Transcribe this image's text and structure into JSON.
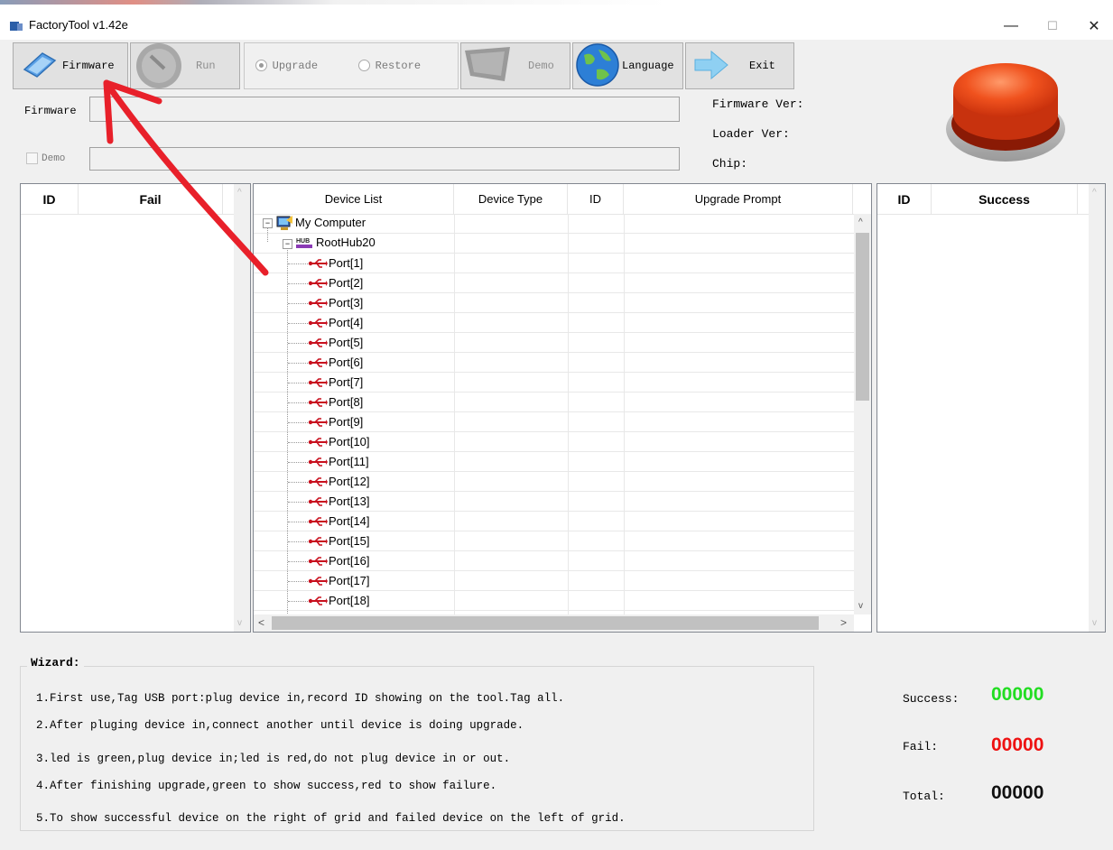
{
  "window": {
    "title": "FactoryTool v1.42e",
    "controls": {
      "minimize": "—",
      "maximize": "☐",
      "close": "✕"
    }
  },
  "toolbar": {
    "firmware_label": "Firmware",
    "run_label": "Run",
    "upgrade_label": "Upgrade",
    "restore_label": "Restore",
    "demo_label": "Demo",
    "language_label": "Language",
    "exit_label": "Exit",
    "selected_mode": "Upgrade"
  },
  "form": {
    "firmware_label": "Firmware",
    "firmware_value": "",
    "demo_checkbox_label": "Demo",
    "demo_checked": false,
    "demo_value": ""
  },
  "info": {
    "firmware_ver_label": "Firmware Ver:",
    "loader_ver_label": "Loader Ver:",
    "chip_label": "Chip:"
  },
  "fail_grid": {
    "headers": [
      "ID",
      "Fail"
    ],
    "rows": []
  },
  "success_grid": {
    "headers": [
      "ID",
      "Success"
    ],
    "rows": []
  },
  "device_grid": {
    "headers": [
      "Device List",
      "Device Type",
      "ID",
      "Upgrade Prompt"
    ],
    "root": "My Computer",
    "hub": "RootHub20",
    "ports": [
      "Port[1]",
      "Port[2]",
      "Port[3]",
      "Port[4]",
      "Port[5]",
      "Port[6]",
      "Port[7]",
      "Port[8]",
      "Port[9]",
      "Port[10]",
      "Port[11]",
      "Port[12]",
      "Port[13]",
      "Port[14]",
      "Port[15]",
      "Port[16]",
      "Port[17]",
      "Port[18]"
    ]
  },
  "wizard": {
    "title": "Wizard:",
    "lines": [
      "1.First use,Tag USB port:plug device in,record ID showing on the tool.Tag all.",
      "2.After pluging device in,connect another until device is doing upgrade.",
      "3.led is green,plug device in;led is red,do not plug device in or out.",
      "4.After finishing upgrade,green to show success,red to show failure.",
      "5.To show successful device on the right of grid and failed device on the left of grid."
    ]
  },
  "stats": {
    "success_label": "Success:",
    "success_value": "00000",
    "fail_label": "Fail:",
    "fail_value": "00000",
    "total_label": "Total:",
    "total_value": "00000"
  },
  "colors": {
    "success": "#22dd22",
    "fail": "#ee1111",
    "total": "#111111",
    "status_led": "#e8401c",
    "annotation_arrow": "#e8202a"
  }
}
